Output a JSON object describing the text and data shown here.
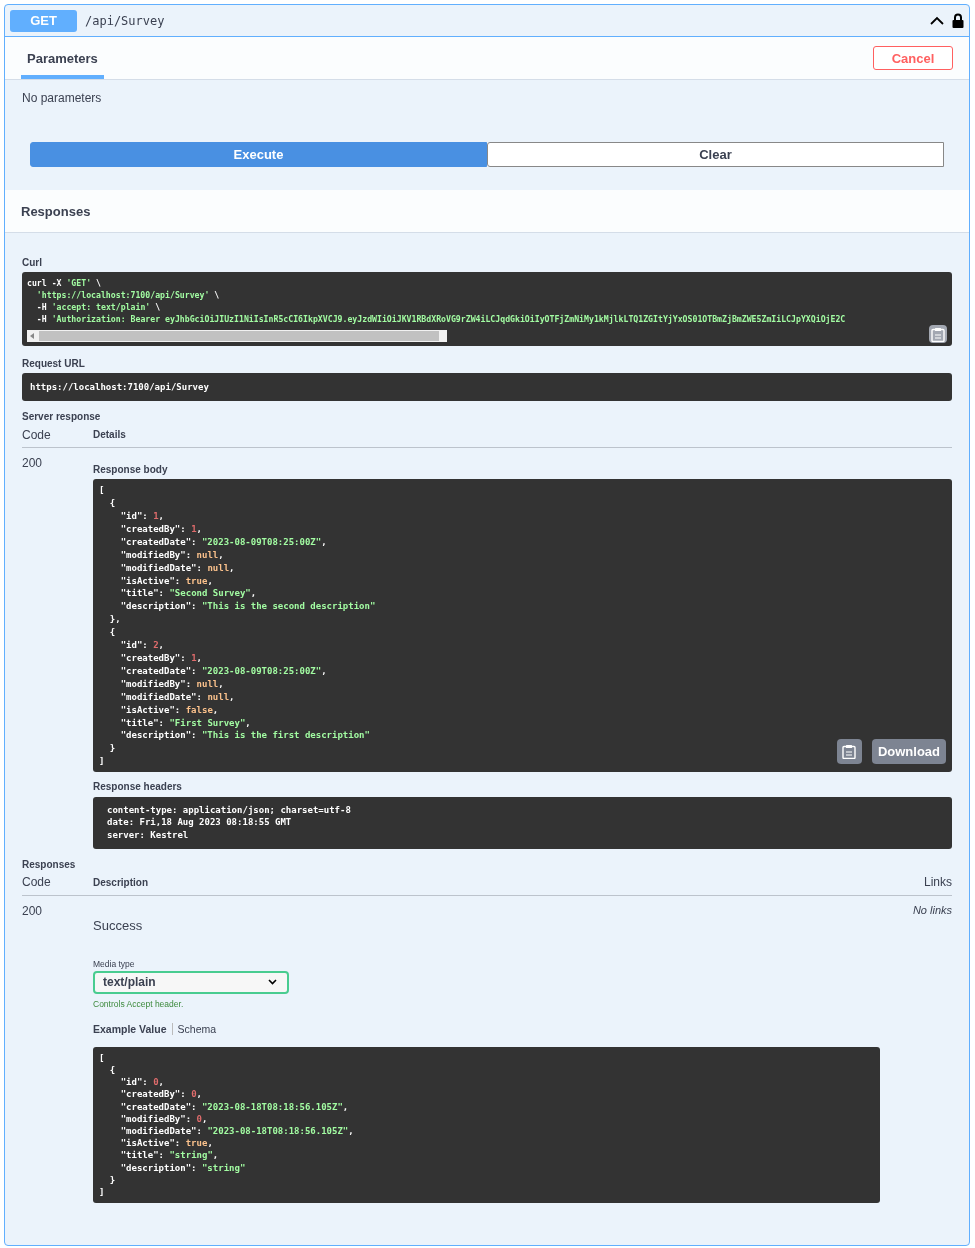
{
  "operation": {
    "method": "GET",
    "path": "/api/Survey",
    "expanded": true,
    "locked": true
  },
  "parameters": {
    "tab": {
      "label": "Parameters",
      "selected": true
    },
    "cancel": "Cancel",
    "empty_text": "No parameters"
  },
  "actions": [
    {
      "label": "Execute",
      "primary": true
    },
    {
      "label": "Clear",
      "primary": false
    }
  ],
  "responses_title": "Responses",
  "curl": {
    "label": "Curl",
    "lines": [
      {
        "text": "curl -X ",
        "value": "'GET'",
        "kind": "string",
        "tail": " \\"
      },
      {
        "value": "  'https://localhost:7100/api/Survey'",
        "kind": "string",
        "tail": " \\"
      },
      {
        "text": "  -H ",
        "value": "'accept: text/plain'",
        "kind": "string",
        "tail": " \\"
      },
      {
        "text": "  -H ",
        "value": "'Authorization: Bearer eyJhbGciOiJIUzI1NiIsInR5cCI6IkpXVCJ9.eyJzdWIiOiJKV1RBdXRoVG9rZW4iLCJqdGkiOiIyOTFjZmNiMy1kMjlkLTQ1ZGItYjYxOS01OTBmZjBmZWE5ZmIiLCJpYXQiOjE2C",
        "kind": "string"
      }
    ]
  },
  "request_url": {
    "label": "Request URL",
    "value": "https://localhost:7100/api/Survey"
  },
  "server_response": {
    "title": "Server response",
    "columns": [
      "Code",
      "Details"
    ],
    "code": "200",
    "body_label": "Response body",
    "body_lines": [
      {
        "text": "["
      },
      {
        "text": "  {"
      },
      {
        "text": "    \"id\": ",
        "value": "1",
        "kind": "number",
        "tail": ","
      },
      {
        "text": "    \"createdBy\": ",
        "value": "1",
        "kind": "number",
        "tail": ","
      },
      {
        "text": "    \"createdDate\": ",
        "value": "\"2023-08-09T08:25:00Z\"",
        "kind": "string",
        "tail": ","
      },
      {
        "text": "    \"modifiedBy\": ",
        "value": "null",
        "kind": "literal",
        "tail": ","
      },
      {
        "text": "    \"modifiedDate\": ",
        "value": "null",
        "kind": "literal",
        "tail": ","
      },
      {
        "text": "    \"isActive\": ",
        "value": "true",
        "kind": "literal",
        "tail": ","
      },
      {
        "text": "    \"title\": ",
        "value": "\"Second Survey\"",
        "kind": "string",
        "tail": ","
      },
      {
        "text": "    \"description\": ",
        "value": "\"This is the second description\"",
        "kind": "string"
      },
      {
        "text": "  },"
      },
      {
        "text": "  {"
      },
      {
        "text": "    \"id\": ",
        "value": "2",
        "kind": "number",
        "tail": ","
      },
      {
        "text": "    \"createdBy\": ",
        "value": "1",
        "kind": "number",
        "tail": ","
      },
      {
        "text": "    \"createdDate\": ",
        "value": "\"2023-08-09T08:25:00Z\"",
        "kind": "string",
        "tail": ","
      },
      {
        "text": "    \"modifiedBy\": ",
        "value": "null",
        "kind": "literal",
        "tail": ","
      },
      {
        "text": "    \"modifiedDate\": ",
        "value": "null",
        "kind": "literal",
        "tail": ","
      },
      {
        "text": "    \"isActive\": ",
        "value": "false",
        "kind": "literal",
        "tail": ","
      },
      {
        "text": "    \"title\": ",
        "value": "\"First Survey\"",
        "kind": "string",
        "tail": ","
      },
      {
        "text": "    \"description\": ",
        "value": "\"This is the first description\"",
        "kind": "string"
      },
      {
        "text": "  }"
      },
      {
        "text": "]"
      }
    ],
    "download": "Download",
    "headers_label": "Response headers",
    "headers_lines": [
      "content-type: application/json; charset=utf-8",
      "date: Fri,18 Aug 2023 08:18:55 GMT",
      "server: Kestrel"
    ]
  },
  "responses": {
    "title": "Responses",
    "columns": [
      "Code",
      "Description",
      "Links"
    ],
    "rows": [
      {
        "code": "200",
        "description": "Success",
        "links": "No links",
        "media_type_label": "Media type",
        "media_type": "text/plain",
        "media_hint": "Controls Accept header.",
        "tabs": [
          {
            "label": "Example Value",
            "selected": true
          },
          {
            "label": "Schema",
            "selected": false
          }
        ],
        "example_lines": [
          {
            "text": "["
          },
          {
            "text": "  {"
          },
          {
            "text": "    \"id\": ",
            "value": "0",
            "kind": "number",
            "tail": ","
          },
          {
            "text": "    \"createdBy\": ",
            "value": "0",
            "kind": "number",
            "tail": ","
          },
          {
            "text": "    \"createdDate\": ",
            "value": "\"2023-08-18T08:18:56.105Z\"",
            "kind": "string",
            "tail": ","
          },
          {
            "text": "    \"modifiedBy\": ",
            "value": "0",
            "kind": "number",
            "tail": ","
          },
          {
            "text": "    \"modifiedDate\": ",
            "value": "\"2023-08-18T08:18:56.105Z\"",
            "kind": "string",
            "tail": ","
          },
          {
            "text": "    \"isActive\": ",
            "value": "true",
            "kind": "literal",
            "tail": ","
          },
          {
            "text": "    \"title\": ",
            "value": "\"string\"",
            "kind": "string",
            "tail": ","
          },
          {
            "text": "    \"description\": ",
            "value": "\"string\"",
            "kind": "string"
          },
          {
            "text": "  }"
          },
          {
            "text": "]"
          }
        ]
      }
    ]
  }
}
